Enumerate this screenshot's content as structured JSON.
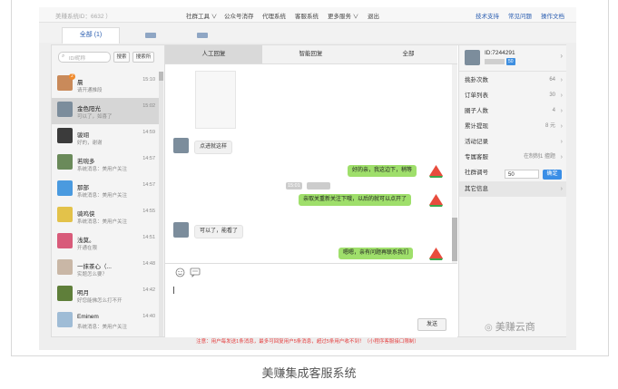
{
  "topbar": {
    "account": "美赚系统ID：6632 ）",
    "menus": [
      "社群工具 ∨",
      "公众号消存",
      "代理系统",
      "客服系统",
      "更多服务 ∨",
      "退出"
    ],
    "links": [
      "技术支持",
      "常见问题",
      "操作文档"
    ]
  },
  "tabs": {
    "active": "全部 (1)"
  },
  "left": {
    "search_placeholder": "ID/昵称",
    "search_button": "搜索",
    "more_button": "搜索所",
    "conversations": [
      {
        "name": "晨",
        "time": "15:10",
        "preview": "请开通推段",
        "badge": "2",
        "color": "#c98a5a",
        "selected": false
      },
      {
        "name": "金色阳光",
        "time": "15:02",
        "preview": "可以了，如喜了",
        "badge": "",
        "color": "#7c8d9c",
        "selected": true
      },
      {
        "name": "骏翊",
        "time": "14:59",
        "preview": "好的，谢谢",
        "badge": "",
        "color": "#3b3b3b",
        "selected": false
      },
      {
        "name": "若琬多",
        "time": "14:57",
        "preview": "系统消息：美用户关注",
        "badge": "",
        "color": "#6a8a5a",
        "selected": false
      },
      {
        "name": "那部",
        "time": "14:57",
        "preview": "系统消息：美用户关注",
        "badge": "",
        "color": "#4a9adf",
        "selected": false
      },
      {
        "name": "骑鸡侠",
        "time": "14:55",
        "preview": "系统消息：美用户关注",
        "badge": "",
        "color": "#e3c24a",
        "selected": false
      },
      {
        "name": "浅莫。",
        "time": "14:51",
        "preview": "开通在限",
        "badge": "",
        "color": "#d85b7a",
        "selected": false
      },
      {
        "name": "一抹茶心（...",
        "time": "14:48",
        "preview": "实题怎么要？",
        "badge": "",
        "color": "#c9b7a6",
        "selected": false
      },
      {
        "name": "明月",
        "time": "14:42",
        "preview": "好您能佛怎么打不开",
        "badge": "",
        "color": "#5f7f3a",
        "selected": false
      },
      {
        "name": "Eminem",
        "time": "14:40",
        "preview": "系统消息：美用户关注",
        "badge": "",
        "color": "#9fbcd6",
        "selected": false
      }
    ]
  },
  "middle": {
    "tabs": [
      "人工回复",
      "智能回复",
      "全部"
    ],
    "messages": [
      {
        "dir": "in",
        "text": "点进就这样"
      },
      {
        "dir": "out",
        "text": "好的亲，我这边下，稍等"
      },
      {
        "dir": "out",
        "text": "亲取关重新关注下哦，以后的就可以点开了"
      },
      {
        "dir": "in",
        "text": "可以了，能看了"
      },
      {
        "dir": "out",
        "text": "嗯嗯，亲有问题再联系我们"
      }
    ],
    "timestamp": "15:01",
    "send_label": "发送"
  },
  "right": {
    "user_id": "ID:7244291",
    "user_tag": "50",
    "rows": [
      {
        "label": "挑卦次数",
        "value": "64"
      },
      {
        "label": "订单列表",
        "value": "30"
      },
      {
        "label": "圈子人数",
        "value": "4"
      },
      {
        "label": "累计提现",
        "value": "8 元"
      },
      {
        "label": "活动记录",
        "value": ""
      },
      {
        "label": "专属客服",
        "value": "在制制1  擅题"
      },
      {
        "label": "社群调号",
        "value": ""
      },
      {
        "label": "其它信息",
        "value": ""
      }
    ],
    "community_value": "50",
    "confirm_label": "确定"
  },
  "notice": "注意：用户每发送1条消息，最多可回复用户5条消息，超过5条用户收不到！（小程序客服接口限制）",
  "watermark": "美赚云商",
  "caption": "美赚集成客服系统"
}
